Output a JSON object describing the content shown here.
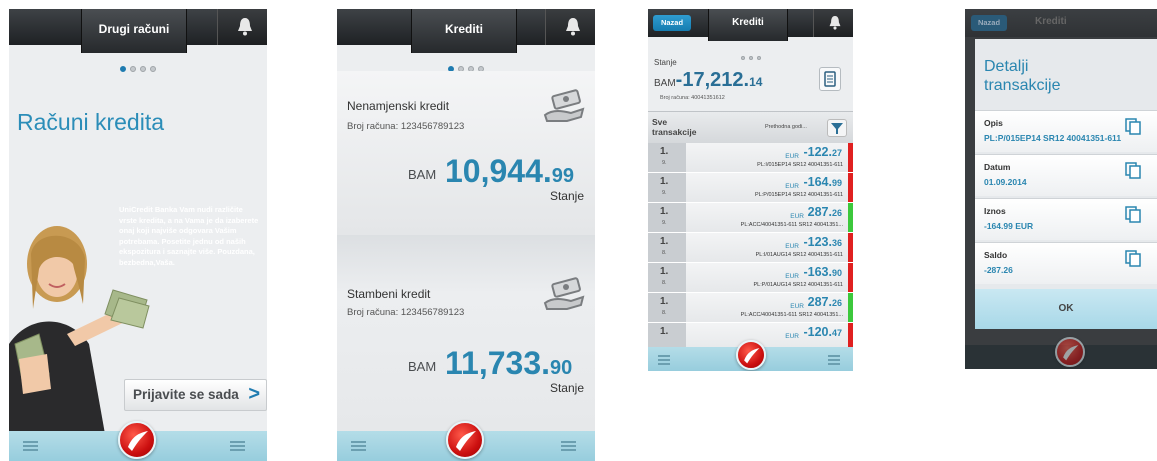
{
  "screen1": {
    "header_title": "Drugi računi",
    "page_title": "Računi kredita",
    "blurb": "UniCredit Banka Vam nudi različite vrste kredita, a na Vama je da izaberete onaj koji najviše odgovara Vašim potrebama. Posetite jednu od naših ekspozitura i saznajte više. Pouzdana, bezbedna,Vaša.",
    "apply_label": "Prijavite se sada",
    "apply_chevron": ">"
  },
  "screen2": {
    "header_title": "Krediti",
    "loans": [
      {
        "name": "Nenamjenski kredit",
        "account": "Broj računa:  123456789123",
        "currency": "BAM",
        "amount_int": "10,944.",
        "amount_dec": "99",
        "balance_label": "Stanje"
      },
      {
        "name": "Stambeni kredit",
        "account": "Broj računa:  123456789123",
        "currency": "BAM",
        "amount_int": "11,733.",
        "amount_dec": "90",
        "balance_label": "Stanje"
      }
    ]
  },
  "screen3": {
    "back_label": "Nazad",
    "header_title": "Krediti",
    "balance_label": "Stanje",
    "balance_currency": "BAM",
    "balance_int": "-17,212.",
    "balance_dec": "14",
    "account_line": "Broj računa:  40041351612",
    "filter_all": "Sve transakcije",
    "filter_prev": "Prethodna godi...",
    "transactions": [
      {
        "day": "1.",
        "month": "9.",
        "currency": "EUR",
        "amount_int": "-122.",
        "amount_dec": "27",
        "desc": "PL:I/015EP14 SR12 40041351-611",
        "status": "#e02020"
      },
      {
        "day": "1.",
        "month": "9.",
        "currency": "EUR",
        "amount_int": "-164.",
        "amount_dec": "99",
        "desc": "PL:P/015EP14 SR12 40041351-611",
        "status": "#e02020"
      },
      {
        "day": "1.",
        "month": "9.",
        "currency": "EUR",
        "amount_int": "287.",
        "amount_dec": "26",
        "desc": "PL:ACC/40041351-611 SR12 40041351...",
        "status": "#3cc83c"
      },
      {
        "day": "1.",
        "month": "8.",
        "currency": "EUR",
        "amount_int": "-123.",
        "amount_dec": "36",
        "desc": "PL:I/01AUG14 SR12 40041351-611",
        "status": "#e02020"
      },
      {
        "day": "1.",
        "month": "8.",
        "currency": "EUR",
        "amount_int": "-163.",
        "amount_dec": "90",
        "desc": "PL:P/01AUG14 SR12 40041351-611",
        "status": "#e02020"
      },
      {
        "day": "1.",
        "month": "8.",
        "currency": "EUR",
        "amount_int": "287.",
        "amount_dec": "26",
        "desc": "PL:ACC/40041351-611 SR12 40041351...",
        "status": "#3cc83c"
      },
      {
        "day": "1.",
        "month": "",
        "currency": "EUR",
        "amount_int": "-120.",
        "amount_dec": "47",
        "desc": "",
        "status": "#e02020"
      }
    ]
  },
  "screen4": {
    "back_label": "Nazad",
    "header_title": "Krediti",
    "dialog_title": "Detalji transakcije",
    "fields": [
      {
        "label": "Opis",
        "value": "PL:P/015EP14 SR12 40041351-611"
      },
      {
        "label": "Datum",
        "value": "01.09.2014"
      },
      {
        "label": "Iznos",
        "value": "-164.99 EUR"
      },
      {
        "label": "Saldo",
        "value": "-287.26"
      }
    ],
    "ok_label": "OK"
  },
  "colors": {
    "accent_blue": "#2a86b0",
    "footer": "#a8d8e8",
    "logo_red": "#d41a12",
    "status_negative": "#e02020",
    "status_positive": "#3cc83c"
  },
  "icons": [
    "bell-icon",
    "menu-icon",
    "unicredit-logo",
    "money-hand-icon",
    "document-icon",
    "filter-icon",
    "copy-icon",
    "chevron-right-icon"
  ]
}
